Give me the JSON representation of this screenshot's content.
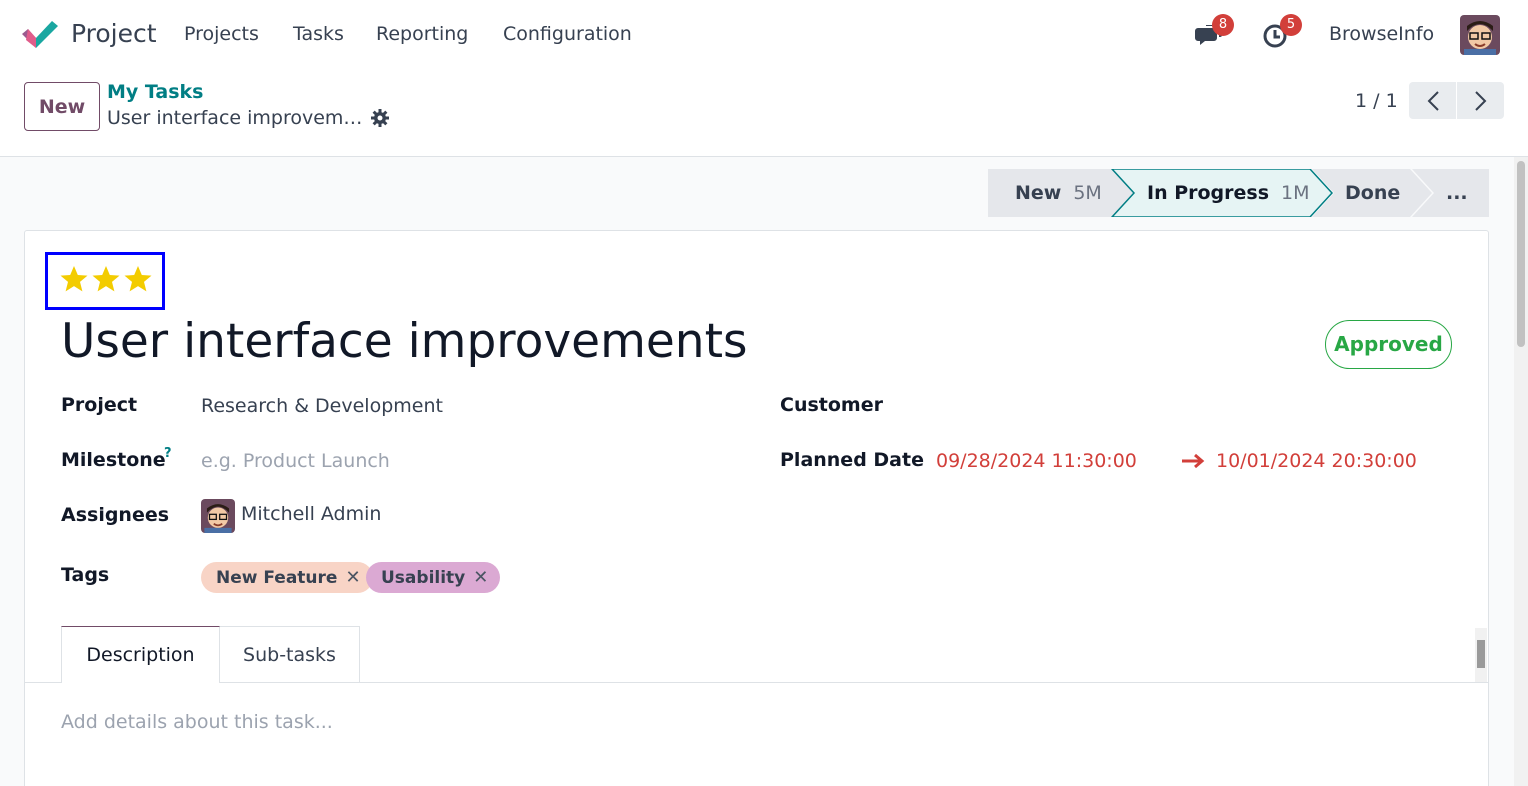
{
  "app": {
    "name": "Project",
    "brand_colors": {
      "primary": "#714b67",
      "teal": "#017e84",
      "badge": "#d23f3a"
    }
  },
  "menu": [
    "Projects",
    "Tasks",
    "Reporting",
    "Configuration"
  ],
  "systray": {
    "messages_count": "8",
    "activities_count": "5",
    "company": "BrowseInfo"
  },
  "control_panel": {
    "new_button": "New",
    "breadcrumb_parent": "My Tasks",
    "breadcrumb_current": "User interface improvem…",
    "pager": "1 / 1"
  },
  "statusbar": {
    "stages": [
      {
        "label": "New",
        "count": "5M"
      },
      {
        "label": "In Progress",
        "count": "1M"
      },
      {
        "label": "Done",
        "count": ""
      }
    ],
    "more": "...",
    "active_stage": "In Progress"
  },
  "task": {
    "priority_stars": 3,
    "title": "User interface improvements",
    "state": "Approved",
    "project_label": "Project",
    "project_value": "Research & Development",
    "milestone_label": "Milestone",
    "milestone_help": "?",
    "milestone_placeholder": "e.g. Product Launch",
    "assignees_label": "Assignees",
    "assignee_name": "Mitchell Admin",
    "tags_label": "Tags",
    "tags": [
      {
        "name": "New Feature",
        "color": "#f8d4c6"
      },
      {
        "name": "Usability",
        "color": "#dba9d3"
      }
    ],
    "customer_label": "Customer",
    "planned_date_label": "Planned Date",
    "planned_start": "09/28/2024 11:30:00",
    "planned_end": "10/01/2024 20:30:00"
  },
  "tabs": {
    "description": "Description",
    "subtasks": "Sub-tasks",
    "description_placeholder": "Add details about this task..."
  }
}
